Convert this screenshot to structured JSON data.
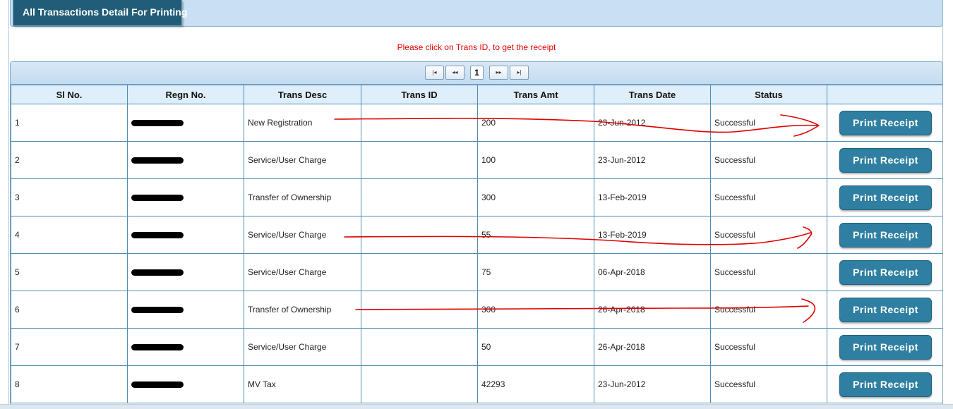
{
  "header": {
    "tab_label": "All Transactions Detail For Printing"
  },
  "instruction": "Please click on Trans ID, to get the receipt",
  "pager": {
    "first": "|◂",
    "prev": "◂◂",
    "current_page": "1",
    "next": "▸▸",
    "last": "▸|"
  },
  "table": {
    "columns": [
      "Sl No.",
      "Regn No.",
      "Trans Desc",
      "Trans ID",
      "Trans Amt",
      "Trans Date",
      "Status",
      ""
    ],
    "button_label": "Print Receipt",
    "rows": [
      {
        "sl": "1",
        "desc": "New Registration",
        "trans_id": "",
        "amt": "200",
        "date": "23-Jun-2012",
        "status": "Successful"
      },
      {
        "sl": "2",
        "desc": "Service/User Charge",
        "trans_id": "",
        "amt": "100",
        "date": "23-Jun-2012",
        "status": "Successful"
      },
      {
        "sl": "3",
        "desc": "Transfer of Ownership",
        "trans_id": "",
        "amt": "300",
        "date": "13-Feb-2019",
        "status": "Successful"
      },
      {
        "sl": "4",
        "desc": "Service/User Charge",
        "trans_id": "",
        "amt": "55",
        "date": "13-Feb-2019",
        "status": "Successful"
      },
      {
        "sl": "5",
        "desc": "Service/User Charge",
        "trans_id": "",
        "amt": "75",
        "date": "06-Apr-2018",
        "status": "Successful"
      },
      {
        "sl": "6",
        "desc": "Transfer of Ownership",
        "trans_id": "",
        "amt": "300",
        "date": "26-Apr-2018",
        "status": "Successful"
      },
      {
        "sl": "7",
        "desc": "Service/User Charge",
        "trans_id": "",
        "amt": "50",
        "date": "26-Apr-2018",
        "status": "Successful"
      },
      {
        "sl": "8",
        "desc": "MV Tax",
        "trans_id": "",
        "amt": "42293",
        "date": "23-Jun-2012",
        "status": "Successful"
      }
    ]
  },
  "colors": {
    "header_tab": "#215d78",
    "instruction": "#e00000",
    "button": "#2e7fa1",
    "annotation": "#e00000"
  }
}
